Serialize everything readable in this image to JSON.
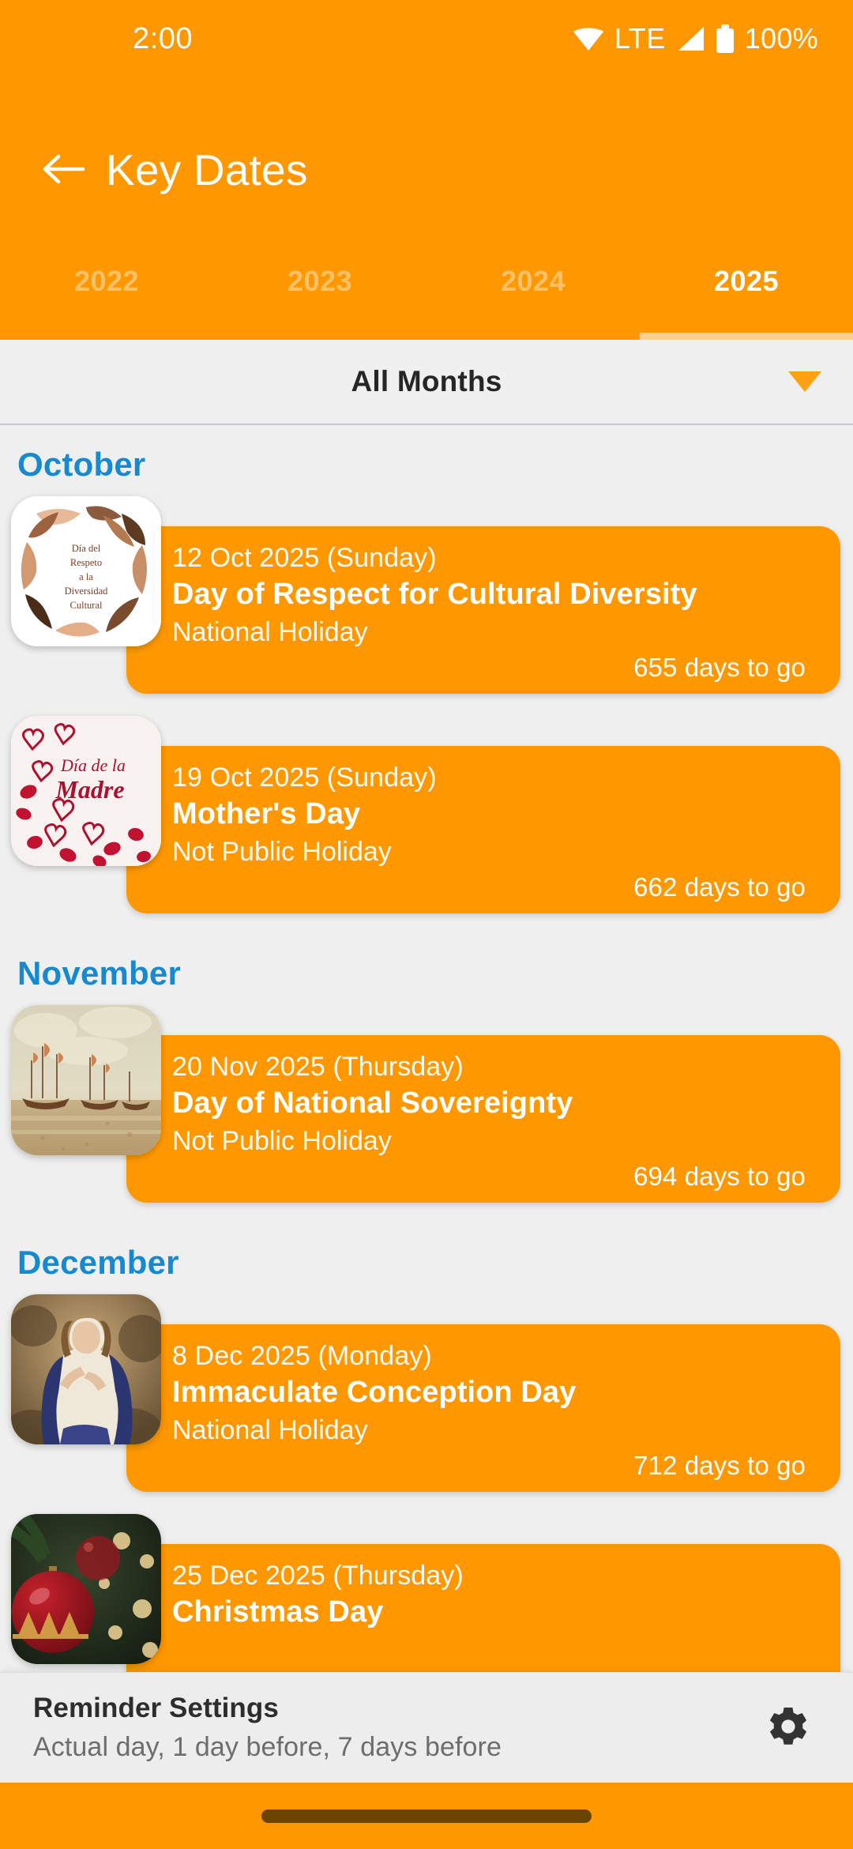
{
  "status_bar": {
    "time": "2:00",
    "network_label": "LTE",
    "battery_percent": "100%",
    "icons": [
      "wifi-icon",
      "signal-icon",
      "battery-icon"
    ]
  },
  "app_bar": {
    "back_icon": "arrow-left-icon",
    "title": "Key Dates"
  },
  "year_tabs": {
    "items": [
      {
        "label": "2022",
        "active": false
      },
      {
        "label": "2023",
        "active": false
      },
      {
        "label": "2024",
        "active": false
      },
      {
        "label": "2025",
        "active": true
      }
    ],
    "selected": "2025"
  },
  "month_filter": {
    "label": "All Months",
    "caret_icon": "chevron-down-icon"
  },
  "sections": [
    {
      "month": "October",
      "events": [
        {
          "date": "12 Oct 2025 (Sunday)",
          "name": "Day of Respect for Cultural Diversity",
          "type": "National Holiday",
          "countdown": "655 days to go",
          "thumbnail": "dia-del-respeto-diversidad-cultural-thumbnail"
        },
        {
          "date": "19 Oct 2025 (Sunday)",
          "name": "Mother's Day",
          "type": "Not Public Holiday",
          "countdown": "662 days to go",
          "thumbnail": "dia-de-la-madre-thumbnail"
        }
      ]
    },
    {
      "month": "November",
      "events": [
        {
          "date": "20 Nov 2025 (Thursday)",
          "name": "Day of National Sovereignty",
          "type": "Not Public Holiday",
          "countdown": "694 days to go",
          "thumbnail": "naval-battle-painting-thumbnail"
        }
      ]
    },
    {
      "month": "December",
      "events": [
        {
          "date": "8 Dec 2025 (Monday)",
          "name": "Immaculate Conception Day",
          "type": "National Holiday",
          "countdown": "712 days to go",
          "thumbnail": "immaculate-conception-painting-thumbnail"
        },
        {
          "date": "25 Dec 2025 (Thursday)",
          "name": "Christmas Day",
          "type": "",
          "countdown": "",
          "thumbnail": "christmas-ornament-thumbnail"
        }
      ]
    }
  ],
  "bottom_bar": {
    "title": "Reminder Settings",
    "subtitle": "Actual day, 1 day before, 7 days before",
    "gear_icon": "gear-icon"
  },
  "colors": {
    "primary_orange": "#FF9800",
    "month_blue": "#1789CF",
    "page_background": "#EFEFEF",
    "bottom_bar_background": "#EDEDED",
    "nav_pill": "#6B4400"
  }
}
